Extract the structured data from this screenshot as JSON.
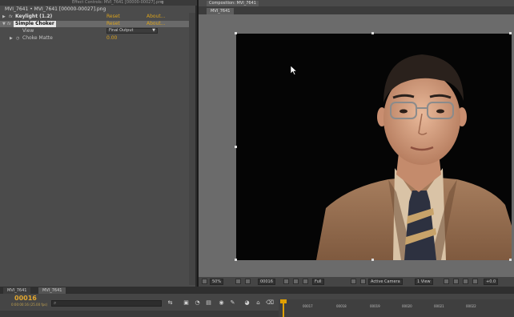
{
  "effect_controls": {
    "tab_label_1": "Effect Controls: MVI_7641 [00000-00027].png",
    "tab_label_2": "",
    "breadcrumb": "MVI_7641 • MVI_7641 [00000-00027].png",
    "effects": [
      {
        "name": "Keylight (1.2)",
        "links": [
          "Reset",
          "About..."
        ],
        "expanded": false
      },
      {
        "name": "Simple Choker",
        "links": [
          "Reset",
          "About..."
        ],
        "expanded": true,
        "selected": true
      }
    ],
    "properties": [
      {
        "name": "View",
        "value": "Final Output"
      },
      {
        "name": "Choke Matte",
        "value": "0.00"
      }
    ]
  },
  "composition": {
    "top_tab": "Composition: MVI_7641",
    "sub_tab": "MVI_7641",
    "footer": {
      "zoom": "50%",
      "timecode": "00016",
      "resolution": "Full",
      "camera": "Active Camera",
      "views": "1 View",
      "exposure": "+0.0"
    }
  },
  "timeline": {
    "tabs": [
      "MVI_7641",
      "MVI_7641"
    ],
    "timecode": "00016",
    "frames_label": "0:00:00:16 (25.00 fps)",
    "search_placeholder": "",
    "ruler_ticks": [
      "00017",
      "00018",
      "00019",
      "00020",
      "00021",
      "00022"
    ]
  },
  "colors": {
    "accent": "#d9a21d",
    "panel": "#4b4b4b",
    "viewer_bg": "#050505"
  },
  "icons": [
    "switch-icon",
    "search-icon",
    "snapshot-icon",
    "grid-icon",
    "camera-icon",
    "fast-preview-icon",
    "draft-icon",
    "motion-blur-icon",
    "graph-icon"
  ]
}
